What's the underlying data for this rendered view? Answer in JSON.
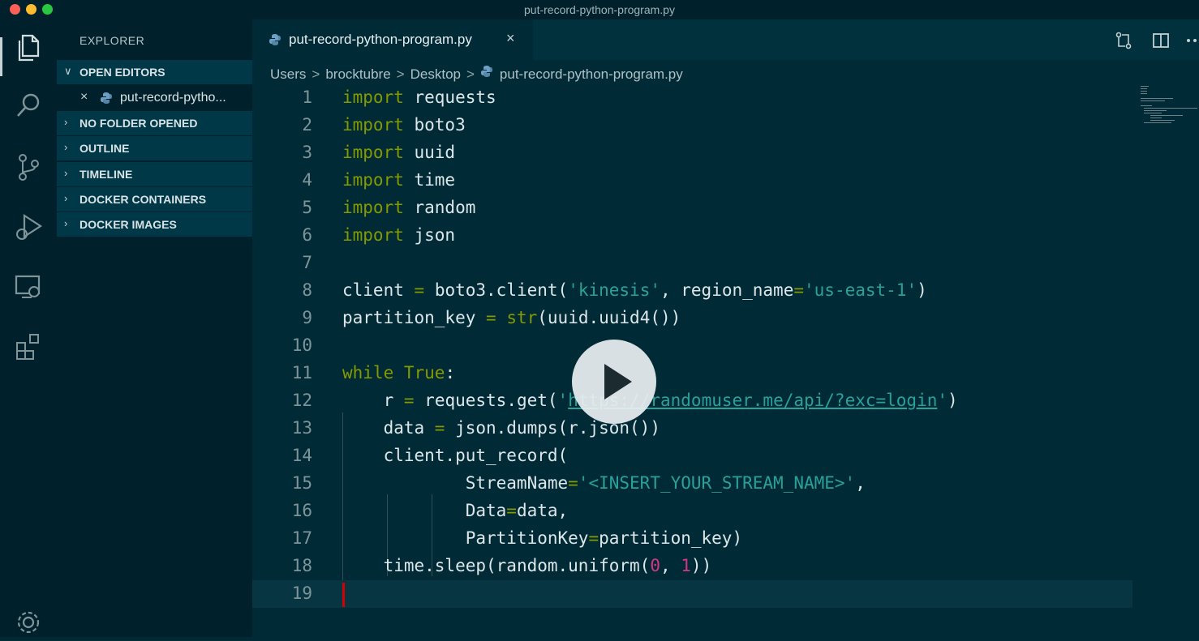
{
  "window": {
    "title": "put-record-python-program.py"
  },
  "activity_bar": {
    "icons": [
      "explorer-icon",
      "search-icon",
      "source-control-icon",
      "run-debug-icon",
      "remote-explorer-icon",
      "extensions-icon",
      "gear-icon"
    ]
  },
  "sidebar": {
    "title": "EXPLORER",
    "sections": [
      {
        "label": "OPEN EDITORS",
        "expanded": true
      },
      {
        "label": "NO FOLDER OPENED",
        "expanded": false
      },
      {
        "label": "OUTLINE",
        "expanded": false
      },
      {
        "label": "TIMELINE",
        "expanded": false
      },
      {
        "label": "DOCKER CONTAINERS",
        "expanded": false
      },
      {
        "label": "DOCKER IMAGES",
        "expanded": false
      }
    ],
    "open_file": "put-record-pytho..."
  },
  "editor": {
    "tab": {
      "label": "put-record-python-program.py",
      "close": "×"
    },
    "breadcrumb": [
      "Users",
      "brocktubre",
      "Desktop",
      "put-record-python-program.py"
    ],
    "breadcrumb_sep": ">",
    "line_numbers": [
      "1",
      "2",
      "3",
      "4",
      "5",
      "6",
      "7",
      "8",
      "9",
      "10",
      "11",
      "12",
      "13",
      "14",
      "15",
      "16",
      "17",
      "18",
      "19"
    ],
    "code": {
      "l1": {
        "kw": "import",
        "rest": " requests"
      },
      "l2": {
        "kw": "import",
        "rest": " boto3"
      },
      "l3": {
        "kw": "import",
        "rest": " uuid"
      },
      "l4": {
        "kw": "import",
        "rest": " time"
      },
      "l5": {
        "kw": "import",
        "rest": " random"
      },
      "l6": {
        "kw": "import",
        "rest": " json"
      },
      "l8": {
        "a": "client ",
        "eq": "=",
        "b": " boto3.client(",
        "s1": "'kinesis'",
        "c": ", region_name",
        "eq2": "=",
        "s2": "'us-east-1'",
        "d": ")"
      },
      "l9": {
        "a": "partition_key ",
        "eq": "=",
        "sp": " ",
        "bi": "str",
        "b": "(uuid.uuid4())"
      },
      "l11": {
        "kw": "while",
        "sp": " ",
        "t": "True",
        "c": ":"
      },
      "l12": {
        "indent": "    ",
        "a": "r ",
        "eq": "=",
        "b": " requests.get(",
        "q1": "'",
        "url": "https://randomuser.me/api/?exc=login",
        "q2": "'",
        "c": ")"
      },
      "l13": {
        "indent": "    ",
        "a": "data ",
        "eq": "=",
        "b": " json.dumps(r.json())"
      },
      "l14": {
        "indent": "    ",
        "a": "client.put_record("
      },
      "l15": {
        "indent": "            ",
        "a": "StreamName",
        "eq": "=",
        "s": "'<INSERT_YOUR_STREAM_NAME>'",
        "c": ","
      },
      "l16": {
        "indent": "            ",
        "a": "Data",
        "eq": "=",
        "b": "data,"
      },
      "l17": {
        "indent": "            ",
        "a": "PartitionKey",
        "eq": "=",
        "b": "partition_key)"
      },
      "l18": {
        "indent": "    ",
        "a": "time.sleep(random.uniform(",
        "n1": "0",
        "c": ", ",
        "n2": "1",
        "d": "))"
      }
    },
    "current_line": "19"
  },
  "colors": {
    "background": "#002b36",
    "keyword": "#859900",
    "string": "#2aa198",
    "number": "#d33682",
    "cursor": "#d30102"
  }
}
